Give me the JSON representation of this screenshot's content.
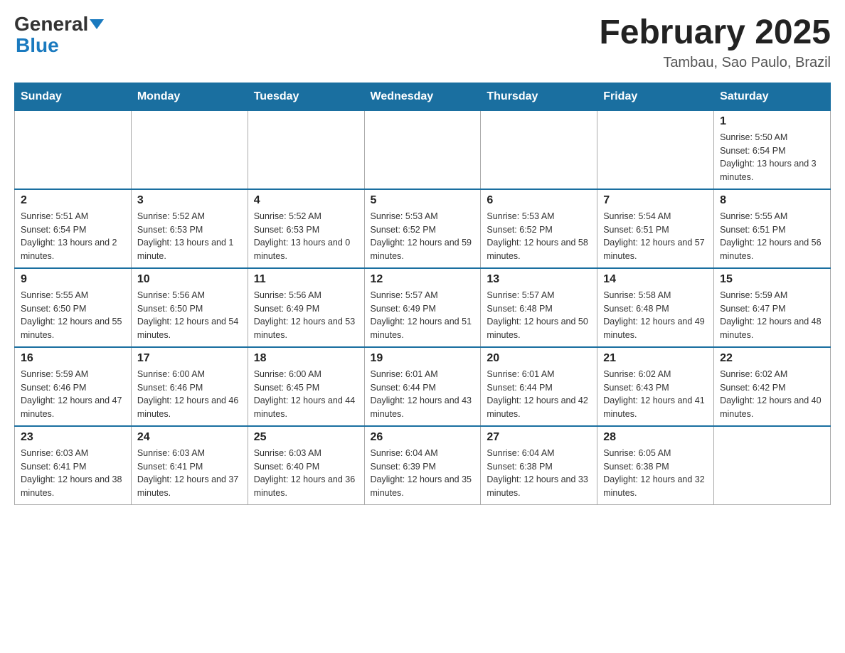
{
  "header": {
    "logo_general": "General",
    "logo_blue": "Blue",
    "title": "February 2025",
    "subtitle": "Tambau, Sao Paulo, Brazil"
  },
  "days_of_week": [
    "Sunday",
    "Monday",
    "Tuesday",
    "Wednesday",
    "Thursday",
    "Friday",
    "Saturday"
  ],
  "weeks": [
    [
      {
        "day": "",
        "info": ""
      },
      {
        "day": "",
        "info": ""
      },
      {
        "day": "",
        "info": ""
      },
      {
        "day": "",
        "info": ""
      },
      {
        "day": "",
        "info": ""
      },
      {
        "day": "",
        "info": ""
      },
      {
        "day": "1",
        "info": "Sunrise: 5:50 AM\nSunset: 6:54 PM\nDaylight: 13 hours and 3 minutes."
      }
    ],
    [
      {
        "day": "2",
        "info": "Sunrise: 5:51 AM\nSunset: 6:54 PM\nDaylight: 13 hours and 2 minutes."
      },
      {
        "day": "3",
        "info": "Sunrise: 5:52 AM\nSunset: 6:53 PM\nDaylight: 13 hours and 1 minute."
      },
      {
        "day": "4",
        "info": "Sunrise: 5:52 AM\nSunset: 6:53 PM\nDaylight: 13 hours and 0 minutes."
      },
      {
        "day": "5",
        "info": "Sunrise: 5:53 AM\nSunset: 6:52 PM\nDaylight: 12 hours and 59 minutes."
      },
      {
        "day": "6",
        "info": "Sunrise: 5:53 AM\nSunset: 6:52 PM\nDaylight: 12 hours and 58 minutes."
      },
      {
        "day": "7",
        "info": "Sunrise: 5:54 AM\nSunset: 6:51 PM\nDaylight: 12 hours and 57 minutes."
      },
      {
        "day": "8",
        "info": "Sunrise: 5:55 AM\nSunset: 6:51 PM\nDaylight: 12 hours and 56 minutes."
      }
    ],
    [
      {
        "day": "9",
        "info": "Sunrise: 5:55 AM\nSunset: 6:50 PM\nDaylight: 12 hours and 55 minutes."
      },
      {
        "day": "10",
        "info": "Sunrise: 5:56 AM\nSunset: 6:50 PM\nDaylight: 12 hours and 54 minutes."
      },
      {
        "day": "11",
        "info": "Sunrise: 5:56 AM\nSunset: 6:49 PM\nDaylight: 12 hours and 53 minutes."
      },
      {
        "day": "12",
        "info": "Sunrise: 5:57 AM\nSunset: 6:49 PM\nDaylight: 12 hours and 51 minutes."
      },
      {
        "day": "13",
        "info": "Sunrise: 5:57 AM\nSunset: 6:48 PM\nDaylight: 12 hours and 50 minutes."
      },
      {
        "day": "14",
        "info": "Sunrise: 5:58 AM\nSunset: 6:48 PM\nDaylight: 12 hours and 49 minutes."
      },
      {
        "day": "15",
        "info": "Sunrise: 5:59 AM\nSunset: 6:47 PM\nDaylight: 12 hours and 48 minutes."
      }
    ],
    [
      {
        "day": "16",
        "info": "Sunrise: 5:59 AM\nSunset: 6:46 PM\nDaylight: 12 hours and 47 minutes."
      },
      {
        "day": "17",
        "info": "Sunrise: 6:00 AM\nSunset: 6:46 PM\nDaylight: 12 hours and 46 minutes."
      },
      {
        "day": "18",
        "info": "Sunrise: 6:00 AM\nSunset: 6:45 PM\nDaylight: 12 hours and 44 minutes."
      },
      {
        "day": "19",
        "info": "Sunrise: 6:01 AM\nSunset: 6:44 PM\nDaylight: 12 hours and 43 minutes."
      },
      {
        "day": "20",
        "info": "Sunrise: 6:01 AM\nSunset: 6:44 PM\nDaylight: 12 hours and 42 minutes."
      },
      {
        "day": "21",
        "info": "Sunrise: 6:02 AM\nSunset: 6:43 PM\nDaylight: 12 hours and 41 minutes."
      },
      {
        "day": "22",
        "info": "Sunrise: 6:02 AM\nSunset: 6:42 PM\nDaylight: 12 hours and 40 minutes."
      }
    ],
    [
      {
        "day": "23",
        "info": "Sunrise: 6:03 AM\nSunset: 6:41 PM\nDaylight: 12 hours and 38 minutes."
      },
      {
        "day": "24",
        "info": "Sunrise: 6:03 AM\nSunset: 6:41 PM\nDaylight: 12 hours and 37 minutes."
      },
      {
        "day": "25",
        "info": "Sunrise: 6:03 AM\nSunset: 6:40 PM\nDaylight: 12 hours and 36 minutes."
      },
      {
        "day": "26",
        "info": "Sunrise: 6:04 AM\nSunset: 6:39 PM\nDaylight: 12 hours and 35 minutes."
      },
      {
        "day": "27",
        "info": "Sunrise: 6:04 AM\nSunset: 6:38 PM\nDaylight: 12 hours and 33 minutes."
      },
      {
        "day": "28",
        "info": "Sunrise: 6:05 AM\nSunset: 6:38 PM\nDaylight: 12 hours and 32 minutes."
      },
      {
        "day": "",
        "info": ""
      }
    ]
  ]
}
